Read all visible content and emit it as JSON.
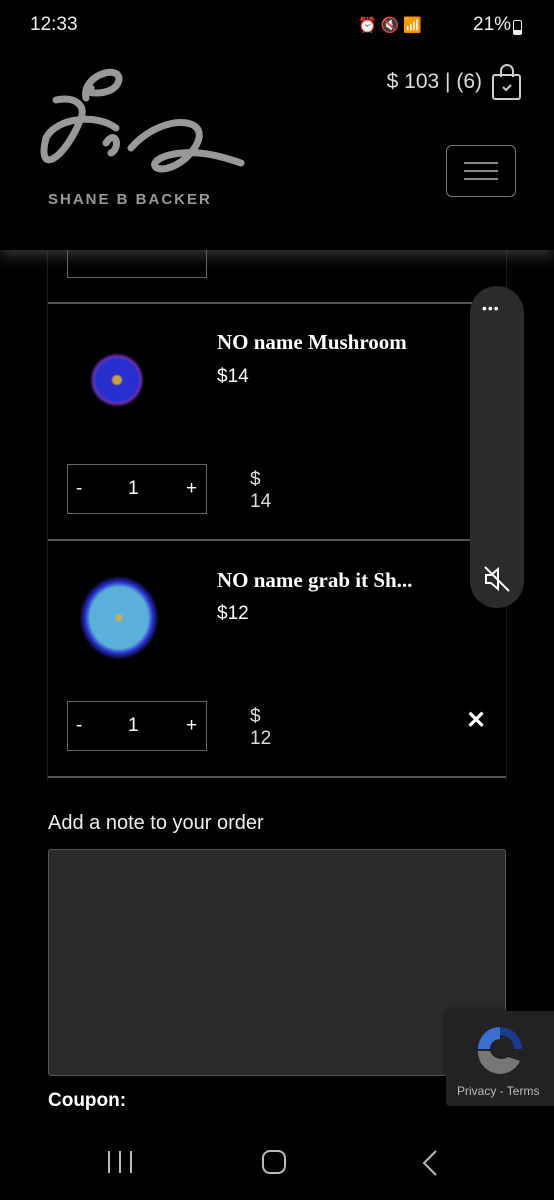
{
  "status_bar": {
    "time": "12:33",
    "battery": "21%"
  },
  "header": {
    "logo_text": "SHANE B BACKER",
    "cart_summary": "$ 103 | (6)"
  },
  "cart": {
    "items": [
      {
        "name": "NO name Mushroom",
        "price": "$14",
        "quantity": "1",
        "line_total": "$ 14",
        "image_color": "#2a2fd0"
      },
      {
        "name": "NO name grab it Sh...",
        "price": "$12",
        "quantity": "1",
        "line_total": "$ 12",
        "image_color": "#4aa0d8"
      }
    ],
    "qty_minus": "-",
    "qty_plus": "+",
    "remove": "✕"
  },
  "note": {
    "label": "Add a note to your order",
    "value": ""
  },
  "coupon": {
    "label": "Coupon:"
  },
  "recaptcha": {
    "links": "Privacy - Terms"
  },
  "floating_panel": {
    "more": "•••"
  }
}
